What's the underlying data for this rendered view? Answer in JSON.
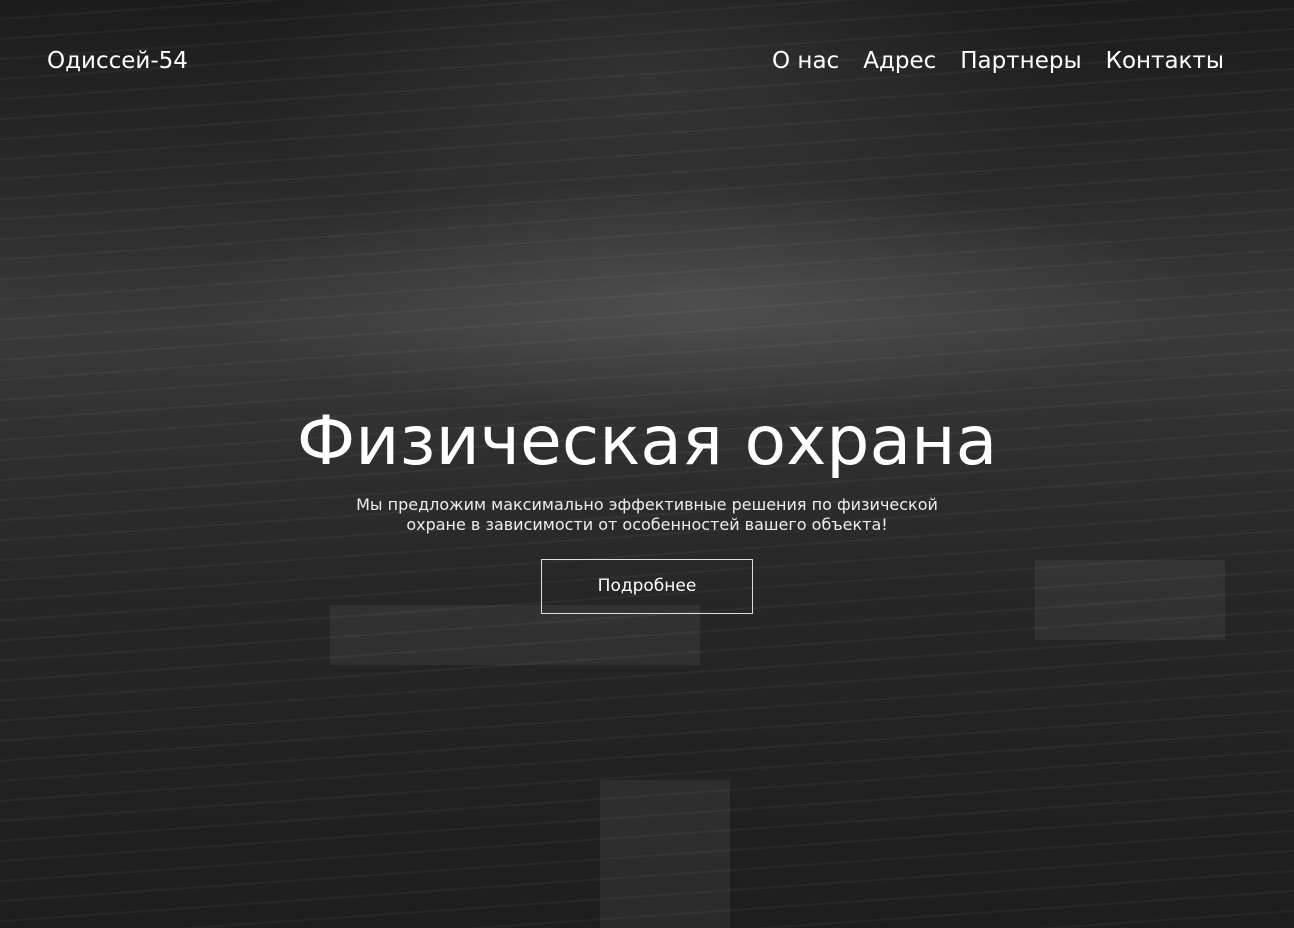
{
  "header": {
    "logo": "Одиссей-54",
    "nav": [
      "О нас",
      "Адрес",
      "Партнеры",
      "Контакты"
    ]
  },
  "hero": {
    "title": "Физическая охрана",
    "subtitle": "Мы предложим максимально эффективные решения по физической охране в зависимости от особенностей вашего объекта!",
    "button": "Подробнее"
  }
}
